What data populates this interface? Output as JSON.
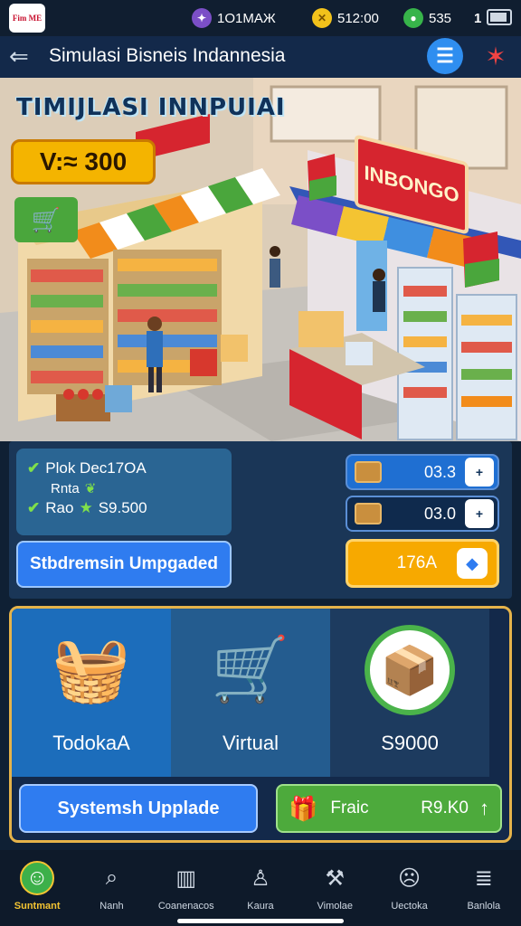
{
  "status_bar": {
    "logo_text": "Fim ME",
    "stats": [
      {
        "icon": "gem-icon",
        "value": "1О1МАЖ"
      },
      {
        "icon": "coin-icon",
        "value": "512:00"
      },
      {
        "icon": "energy-icon",
        "value": "535"
      },
      {
        "icon": "level-icon",
        "value": "1"
      }
    ]
  },
  "header": {
    "title": "Simulasi Bisneis Indannesia"
  },
  "scene": {
    "title": "TIMIJLASI INNPUIAI",
    "money": "V:≈ 300",
    "store_sign": "INBONGO"
  },
  "info": {
    "line1": "Plok Dec17OA",
    "line1_sub": "Rnta",
    "line2_label": "Rao",
    "line2_value": "S9.500",
    "upgrade_label": "Stbdremsin Umpgaded"
  },
  "resources": [
    {
      "icon": "crate-icon",
      "value": "03.3",
      "btn": "+"
    },
    {
      "icon": "box-icon",
      "value": "03.0",
      "btn": "+"
    }
  ],
  "price_button": {
    "label": "176A"
  },
  "actions": {
    "col1": {
      "icon": "basket-icon",
      "label": "TodokaA"
    },
    "col2": {
      "icon": "shopping-cart-icon",
      "label": "Virtual"
    },
    "col3": {
      "icon": "produce-box-icon",
      "label": "S9000"
    },
    "system_button": "Systemsh Upplade",
    "gift_button": {
      "label": "Fraic",
      "value": "R9.K0"
    }
  },
  "nav": [
    {
      "label": "Suntmant",
      "icon": "avatar-icon",
      "active": true
    },
    {
      "label": "Nanh",
      "icon": "search-icon",
      "active": false
    },
    {
      "label": "Coanenacos",
      "icon": "chart-icon",
      "active": false
    },
    {
      "label": "Kaura",
      "icon": "profile-icon",
      "active": false
    },
    {
      "label": "Vimolae",
      "icon": "tools-icon",
      "active": false
    },
    {
      "label": "Uectoka",
      "icon": "face-icon",
      "active": false
    },
    {
      "label": "Banlola",
      "icon": "layers-icon",
      "active": false
    }
  ],
  "colors": {
    "accent_blue": "#2f7cf0",
    "accent_orange": "#f7a900",
    "accent_green": "#4daa3c",
    "panel_border_gold": "#e5b34a"
  }
}
